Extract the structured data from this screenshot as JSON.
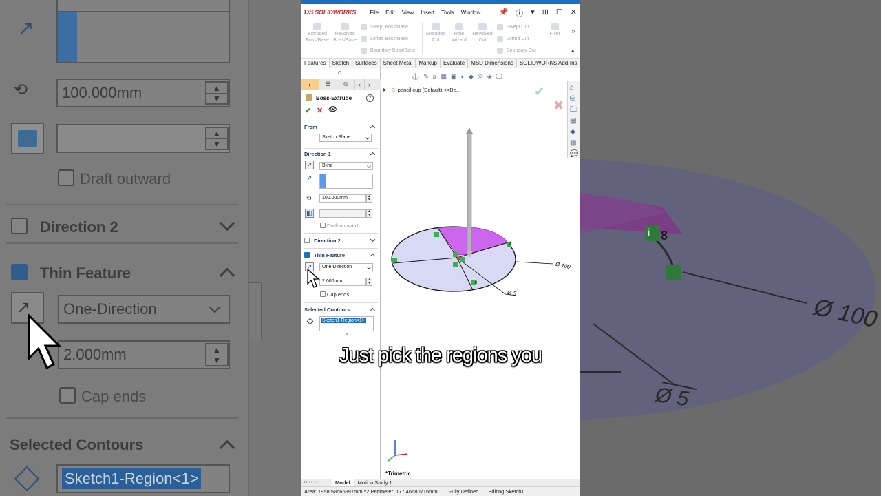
{
  "app": {
    "name": "SOLIDWORKS",
    "menus": [
      "File",
      "Edit",
      "View",
      "Insert",
      "Tools",
      "Window"
    ]
  },
  "ribbon": {
    "extruded_boss": "Extruded\nBoss/Base",
    "revolved_boss": "Revolved\nBoss/Base",
    "swept_boss": "Swept Boss/Base",
    "lofted_boss": "Lofted Boss/Base",
    "boundary_boss": "Boundary Boss/Base",
    "extruded_cut": "Extruded\nCut",
    "hole_wizard": "Hole\nWizard",
    "revolved_cut": "Revolved\nCut",
    "swept_cut": "Swept Cut",
    "lofted_cut": "Lofted Cut",
    "boundary_cut": "Boundary Cut",
    "fillet": "Fillet"
  },
  "tabs": [
    "Features",
    "Sketch",
    "Surfaces",
    "Sheet Metal",
    "Markup",
    "Evaluate",
    "MBD Dimensions",
    "SOLIDWORKS Add-Ins"
  ],
  "tree": {
    "part_label": "pencil cup (Default) <<De..."
  },
  "property_manager": {
    "title": "Boss-Extrude",
    "from": {
      "heading": "From",
      "value": "Sketch Plane"
    },
    "direction1": {
      "heading": "Direction 1",
      "end_condition": "Blind",
      "depth": "100.000mm",
      "draft_outward": "Draft outward"
    },
    "direction2": {
      "heading": "Direction 2"
    },
    "thin_feature": {
      "heading": "Thin Feature",
      "type": "One-Direction",
      "thickness": "2.000mm",
      "cap_ends": "Cap ends"
    },
    "selected_contours": {
      "heading": "Selected Contours",
      "value": "Sketch1-Region<1>"
    }
  },
  "viewport": {
    "view_label": "*Trimetric",
    "dim_100": "Ø 100",
    "dim_5": "Ø 5",
    "region_color": "#cc66ee",
    "disk_color": "#d8d9f5",
    "relation_labels": [
      "8",
      "8"
    ]
  },
  "bottom_tabs": [
    "Model",
    "Motion Study 1"
  ],
  "status": {
    "area": "Area: 1958.58666997mm ^2 Perimeter: 177.46680716mm",
    "defined": "Fully Defined",
    "editing": "Editing Sketch1"
  },
  "caption": "Just pick the regions you",
  "background_zoom": {
    "depth": "100.000mm",
    "draft_outward": "Draft outward",
    "direction2": "Direction 2",
    "thin_feature": "Thin Feature",
    "type": "One-Direction",
    "thickness": "2.000mm",
    "cap_ends": "Cap ends",
    "selected_contours": "Selected Contours",
    "contour": "Sketch1-Region<1>",
    "dim_100": "Ø 100",
    "dim_5": "Ø 5",
    "relation_label": "8"
  }
}
